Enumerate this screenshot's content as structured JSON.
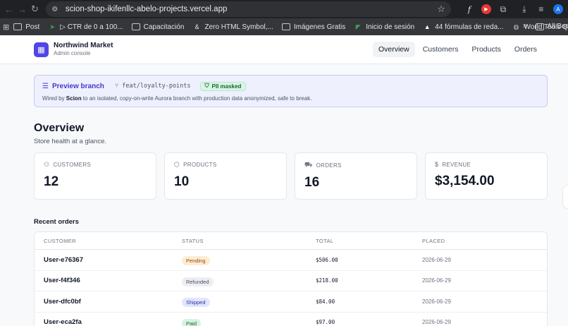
{
  "browser": {
    "url": "scion-shop-ikifenllc-abelo-projects.vercel.app",
    "extensions": [
      {
        "icon": "function-icon",
        "glyph": "fx"
      },
      {
        "icon": "youtube-icon",
        "glyph": "▶"
      },
      {
        "icon": "puzzle-icon",
        "glyph": "⧉"
      }
    ],
    "profile_initial": "A",
    "bookmarks": [
      {
        "label": "Post",
        "icon": "folder-icon"
      },
      {
        "label": "▷ CTR de 0 a 100...",
        "icon": "arrow-icon"
      },
      {
        "label": "Capacitación",
        "icon": "folder-icon"
      },
      {
        "label": "Zero HTML Symbol,...",
        "icon": "ampersand-icon"
      },
      {
        "label": "Imágenes Gratis",
        "icon": "folder-icon"
      },
      {
        "label": "Inicio de sesión",
        "icon": "leaf-icon"
      },
      {
        "label": "44 fórmulas de reda...",
        "icon": "flame-icon"
      },
      {
        "label": "World Tools Quest...",
        "icon": "globe-icon"
      }
    ],
    "all_bookmarks_label": "All Boo"
  },
  "app": {
    "name": "Northwind Market",
    "subtitle": "Admin console",
    "nav": [
      {
        "label": "Overview",
        "active": true
      },
      {
        "label": "Customers",
        "active": false
      },
      {
        "label": "Products",
        "active": false
      },
      {
        "label": "Orders",
        "active": false
      }
    ]
  },
  "banner": {
    "title": "Preview branch",
    "branch": "feat/loyalty-points",
    "badge": "PII masked",
    "desc_prefix": "Wired by ",
    "desc_brand": "Scion",
    "desc_suffix": " to an isolated, copy-on-write Aurora branch with production data anonymized, safe to break."
  },
  "overview": {
    "title": "Overview",
    "subtitle": "Store health at a glance."
  },
  "stats": [
    {
      "label": "CUSTOMERS",
      "value": "12",
      "icon": "users-icon"
    },
    {
      "label": "PRODUCTS",
      "value": "10",
      "icon": "box-icon"
    },
    {
      "label": "ORDERS",
      "value": "16",
      "icon": "cart-icon"
    },
    {
      "label": "REVENUE",
      "value": "$3,154.00",
      "icon": "dollar-icon"
    }
  ],
  "orders": {
    "title": "Recent orders",
    "headers": [
      "CUSTOMER",
      "STATUS",
      "TOTAL",
      "PLACED"
    ],
    "rows": [
      {
        "customer": "User-e76367",
        "status": "Pending",
        "total": "$506.00",
        "placed": "2026-06-29"
      },
      {
        "customer": "User-f4f346",
        "status": "Refunded",
        "total": "$218.00",
        "placed": "2026-06-29"
      },
      {
        "customer": "User-dfc0bf",
        "status": "Shipped",
        "total": "$84.00",
        "placed": "2026-06-29"
      },
      {
        "customer": "User-eca2fa",
        "status": "Paid",
        "total": "$97.00",
        "placed": "2026-06-29"
      }
    ]
  },
  "colors": {
    "accent": "#4f46e5",
    "banner_bg": "#eef0fd",
    "status_pending": "#fdecd3",
    "status_refunded": "#eceef1",
    "status_shipped": "#e0e6fd",
    "status_paid": "#d7f3e1"
  }
}
